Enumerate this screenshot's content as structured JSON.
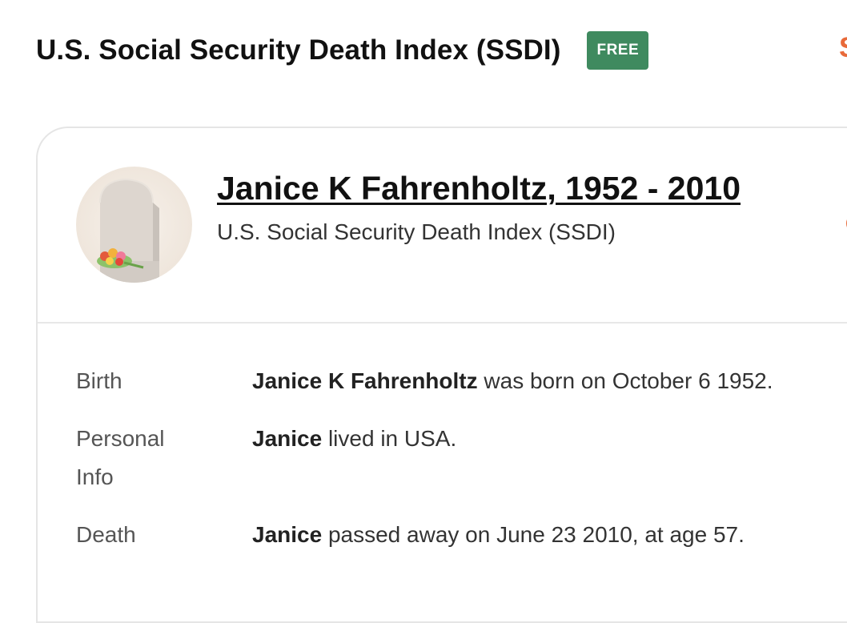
{
  "header": {
    "title": "U.S. Social Security Death Index (SSDI)",
    "badge": "FREE",
    "edge_text": "S"
  },
  "record": {
    "name": "Janice K Fahrenholtz, 1952 - 2010",
    "collection": "U.S. Social Security Death Index (SSDI)",
    "avatar_icon": "tombstone-with-flowers-icon"
  },
  "facts": [
    {
      "label": "Birth",
      "name": "Janice K Fahrenholtz",
      "text": " was born on October 6 1952."
    },
    {
      "label_line1": "Personal",
      "label_line2": "Info",
      "name": "Janice",
      "text": " lived in USA."
    },
    {
      "label": "Death",
      "name": "Janice",
      "text": " passed away on June 23 2010, at age 57."
    }
  ],
  "colors": {
    "badge_bg": "#3f8a5f",
    "accent": "#e86a3a",
    "border": "#e5e5e5"
  }
}
